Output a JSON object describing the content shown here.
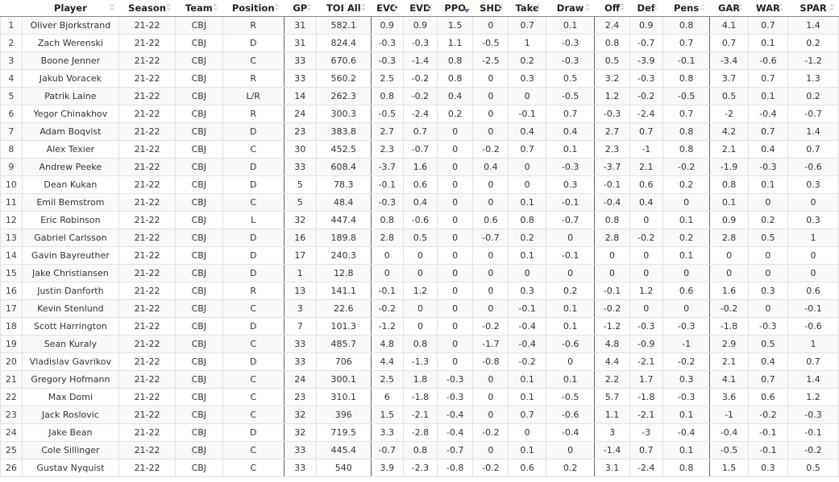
{
  "table": {
    "sorted_column": "PPO",
    "sort_direction": "descending",
    "sort_active_color": "#6b6bd6",
    "columns": [
      "",
      "Player",
      "Season",
      "Team",
      "Position",
      "GP",
      "TOI All",
      "EVO",
      "EVD",
      "PPO",
      "SHD",
      "Take",
      "Draw",
      "Off",
      "Def",
      "Pens",
      "GAR",
      "WAR",
      "SPAR"
    ],
    "rows": [
      [
        "1",
        "Oliver Bjorkstrand",
        "21-22",
        "CBJ",
        "R",
        "31",
        "582.1",
        "0.9",
        "0.9",
        "1.5",
        "0",
        "0.7",
        "0.1",
        "2.4",
        "0.9",
        "0.8",
        "4.1",
        "0.7",
        "1.4"
      ],
      [
        "2",
        "Zach Werenski",
        "21-22",
        "CBJ",
        "D",
        "31",
        "824.4",
        "-0.3",
        "-0.3",
        "1.1",
        "-0.5",
        "1",
        "-0.3",
        "0.8",
        "-0.7",
        "0.7",
        "0.7",
        "0.1",
        "0.2"
      ],
      [
        "3",
        "Boone Jenner",
        "21-22",
        "CBJ",
        "C",
        "33",
        "670.6",
        "-0.3",
        "-1.4",
        "0.8",
        "-2.5",
        "0.2",
        "-0.3",
        "0.5",
        "-3.9",
        "-0.1",
        "-3.4",
        "-0.6",
        "-1.2"
      ],
      [
        "4",
        "Jakub Voracek",
        "21-22",
        "CBJ",
        "R",
        "33",
        "560.2",
        "2.5",
        "-0.2",
        "0.8",
        "0",
        "0.3",
        "0.5",
        "3.2",
        "-0.3",
        "0.8",
        "3.7",
        "0.7",
        "1.3"
      ],
      [
        "5",
        "Patrik Laine",
        "21-22",
        "CBJ",
        "L/R",
        "14",
        "262.3",
        "0.8",
        "-0.2",
        "0.4",
        "0",
        "0",
        "-0.5",
        "1.2",
        "-0.2",
        "-0.5",
        "0.5",
        "0.1",
        "0.2"
      ],
      [
        "6",
        "Yegor Chinakhov",
        "21-22",
        "CBJ",
        "R",
        "24",
        "300.3",
        "-0.5",
        "-2.4",
        "0.2",
        "0",
        "-0.1",
        "0.7",
        "-0.3",
        "-2.4",
        "0.7",
        "-2",
        "-0.4",
        "-0.7"
      ],
      [
        "7",
        "Adam Boqvist",
        "21-22",
        "CBJ",
        "D",
        "23",
        "383.8",
        "2.7",
        "0.7",
        "0",
        "0",
        "0.4",
        "0.4",
        "2.7",
        "0.7",
        "0.8",
        "4.2",
        "0.7",
        "1.4"
      ],
      [
        "8",
        "Alex Texier",
        "21-22",
        "CBJ",
        "C",
        "30",
        "452.5",
        "2.3",
        "-0.7",
        "0",
        "-0.2",
        "0.7",
        "0.1",
        "2.3",
        "-1",
        "0.8",
        "2.1",
        "0.4",
        "0.7"
      ],
      [
        "9",
        "Andrew Peeke",
        "21-22",
        "CBJ",
        "D",
        "33",
        "608.4",
        "-3.7",
        "1.6",
        "0",
        "0.4",
        "0",
        "-0.3",
        "-3.7",
        "2.1",
        "-0.2",
        "-1.9",
        "-0.3",
        "-0.6"
      ],
      [
        "10",
        "Dean Kukan",
        "21-22",
        "CBJ",
        "D",
        "5",
        "78.3",
        "-0.1",
        "0.6",
        "0",
        "0",
        "0",
        "0.3",
        "-0.1",
        "0.6",
        "0.2",
        "0.8",
        "0.1",
        "0.3"
      ],
      [
        "11",
        "Emil Bemstrom",
        "21-22",
        "CBJ",
        "C",
        "5",
        "48.4",
        "-0.3",
        "0.4",
        "0",
        "0",
        "0.1",
        "-0.1",
        "-0.4",
        "0.4",
        "0",
        "0.1",
        "0",
        "0"
      ],
      [
        "12",
        "Eric Robinson",
        "21-22",
        "CBJ",
        "L",
        "32",
        "447.4",
        "0.8",
        "-0.6",
        "0",
        "0.6",
        "0.8",
        "-0.7",
        "0.8",
        "0",
        "0.1",
        "0.9",
        "0.2",
        "0.3"
      ],
      [
        "13",
        "Gabriel Carlsson",
        "21-22",
        "CBJ",
        "D",
        "16",
        "189.8",
        "2.8",
        "0.5",
        "0",
        "-0.7",
        "0.2",
        "0",
        "2.8",
        "-0.2",
        "0.2",
        "2.8",
        "0.5",
        "1"
      ],
      [
        "14",
        "Gavin Bayreuther",
        "21-22",
        "CBJ",
        "D",
        "17",
        "240.3",
        "0",
        "0",
        "0",
        "0",
        "0.1",
        "-0.1",
        "0",
        "0",
        "0.1",
        "0",
        "0",
        "0"
      ],
      [
        "15",
        "Jake Christiansen",
        "21-22",
        "CBJ",
        "D",
        "1",
        "12.8",
        "0",
        "0",
        "0",
        "0",
        "0",
        "0",
        "0",
        "0",
        "0",
        "0",
        "0",
        "0"
      ],
      [
        "16",
        "Justin Danforth",
        "21-22",
        "CBJ",
        "R",
        "13",
        "141.1",
        "-0.1",
        "1.2",
        "0",
        "0",
        "0.3",
        "0.2",
        "-0.1",
        "1.2",
        "0.6",
        "1.6",
        "0.3",
        "0.6"
      ],
      [
        "17",
        "Kevin Stenlund",
        "21-22",
        "CBJ",
        "C",
        "3",
        "22.6",
        "-0.2",
        "0",
        "0",
        "0",
        "-0.1",
        "0.1",
        "-0.2",
        "0",
        "0",
        "-0.2",
        "0",
        "-0.1"
      ],
      [
        "18",
        "Scott Harrington",
        "21-22",
        "CBJ",
        "D",
        "7",
        "101.3",
        "-1.2",
        "0",
        "0",
        "-0.2",
        "-0.4",
        "0.1",
        "-1.2",
        "-0.3",
        "-0.3",
        "-1.8",
        "-0.3",
        "-0.6"
      ],
      [
        "19",
        "Sean Kuraly",
        "21-22",
        "CBJ",
        "C",
        "33",
        "485.7",
        "4.8",
        "0.8",
        "0",
        "-1.7",
        "-0.4",
        "-0.6",
        "4.8",
        "-0.9",
        "-1",
        "2.9",
        "0.5",
        "1"
      ],
      [
        "20",
        "Vladislav Gavrikov",
        "21-22",
        "CBJ",
        "D",
        "33",
        "706",
        "4.4",
        "-1.3",
        "0",
        "-0.8",
        "-0.2",
        "0",
        "4.4",
        "-2.1",
        "-0.2",
        "2.1",
        "0.4",
        "0.7"
      ],
      [
        "21",
        "Gregory Hofmann",
        "21-22",
        "CBJ",
        "C",
        "24",
        "300.1",
        "2.5",
        "1.8",
        "-0.3",
        "0",
        "0.1",
        "0.1",
        "2.2",
        "1.7",
        "0.3",
        "4.1",
        "0.7",
        "1.4"
      ],
      [
        "22",
        "Max Domi",
        "21-22",
        "CBJ",
        "C",
        "23",
        "310.1",
        "6",
        "-1.8",
        "-0.3",
        "0",
        "0.1",
        "-0.5",
        "5.7",
        "-1.8",
        "-0.3",
        "3.6",
        "0.6",
        "1.2"
      ],
      [
        "23",
        "Jack Roslovic",
        "21-22",
        "CBJ",
        "C",
        "32",
        "396",
        "1.5",
        "-2.1",
        "-0.4",
        "0",
        "0.7",
        "-0.6",
        "1.1",
        "-2.1",
        "0.1",
        "-1",
        "-0.2",
        "-0.3"
      ],
      [
        "24",
        "Jake Bean",
        "21-22",
        "CBJ",
        "D",
        "32",
        "719.5",
        "3.3",
        "-2.8",
        "-0.4",
        "-0.2",
        "0",
        "-0.4",
        "3",
        "-3",
        "-0.4",
        "-0.4",
        "-0.1",
        "-0.1"
      ],
      [
        "25",
        "Cole Sillinger",
        "21-22",
        "CBJ",
        "C",
        "33",
        "445.4",
        "-0.7",
        "0.8",
        "-0.7",
        "0",
        "0.1",
        "0",
        "-1.4",
        "0.7",
        "0.1",
        "-0.5",
        "-0.1",
        "-0.2"
      ],
      [
        "26",
        "Gustav Nyquist",
        "21-22",
        "CBJ",
        "C",
        "33",
        "540",
        "3.9",
        "-2.3",
        "-0.8",
        "-0.2",
        "0.6",
        "0.2",
        "3.1",
        "-2.4",
        "0.8",
        "1.5",
        "0.3",
        "0.5"
      ]
    ]
  }
}
